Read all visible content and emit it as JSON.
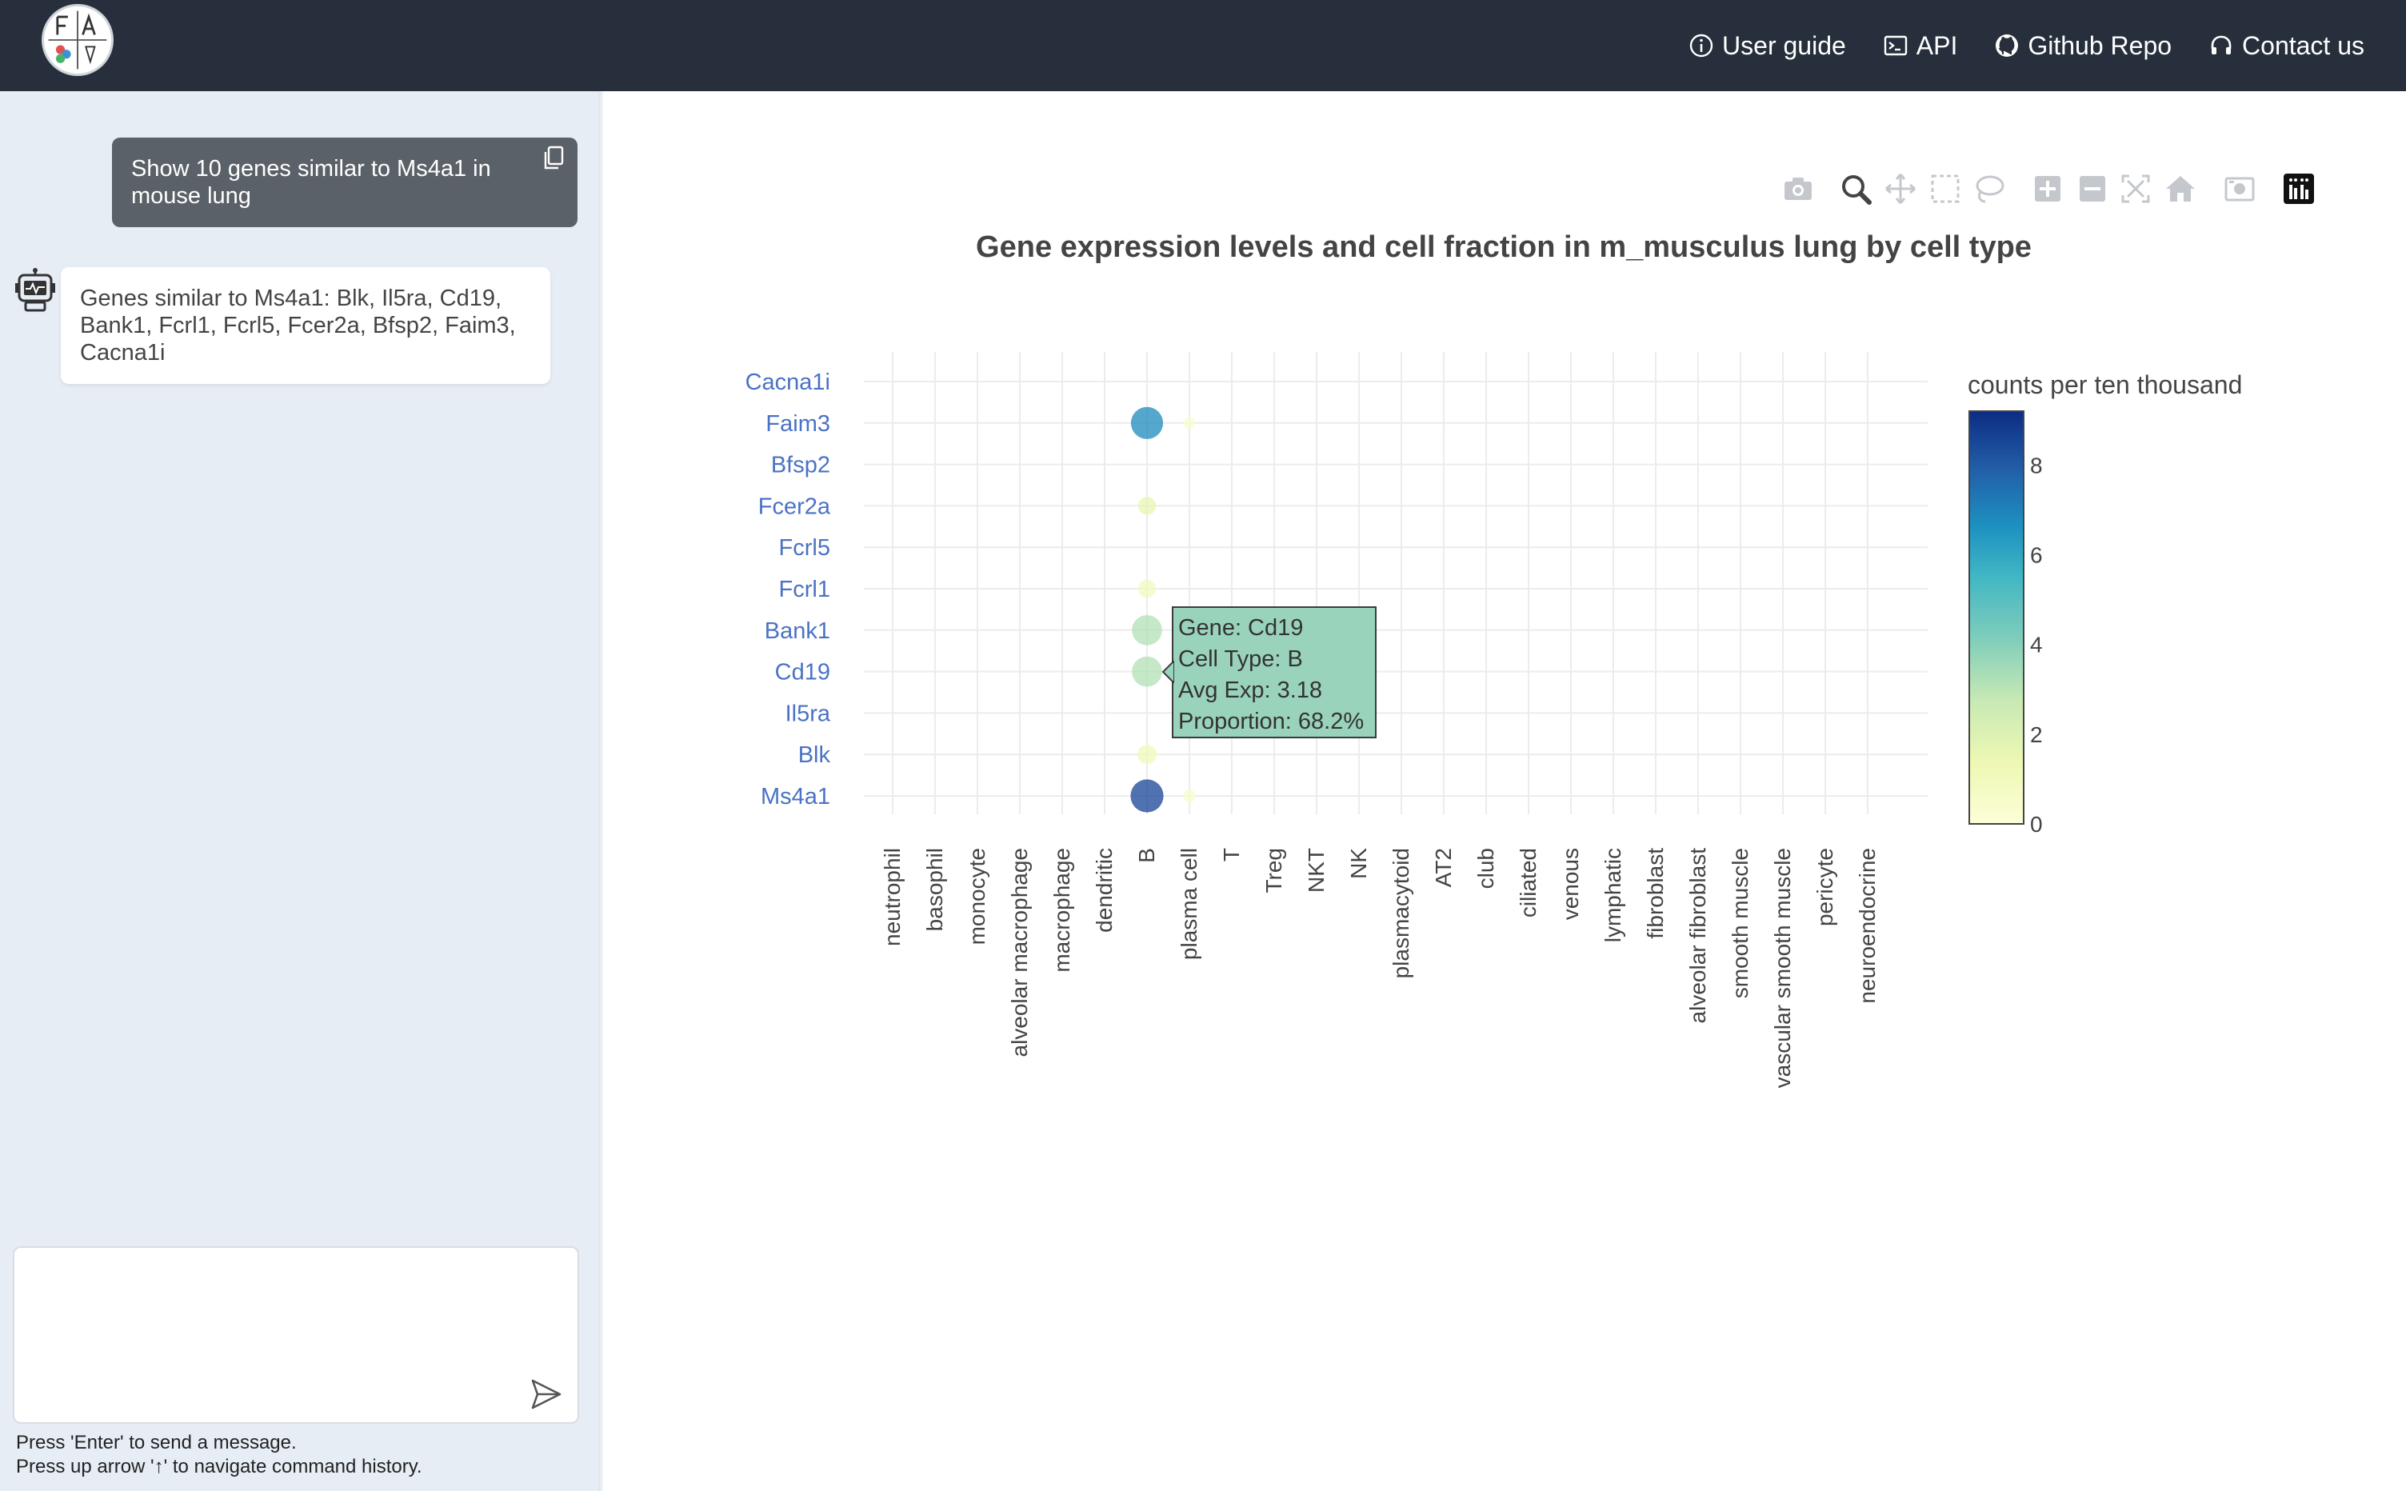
{
  "nav": {
    "user_guide": "User guide",
    "api": "API",
    "github": "Github Repo",
    "contact": "Contact us"
  },
  "chat": {
    "user_message": "Show 10 genes similar to Ms4a1 in mouse lung",
    "bot_message": "Genes similar to Ms4a1: Blk, Il5ra, Cd19, Bank1, Fcrl1, Fcrl5, Fcer2a, Bfsp2, Faim3, Cacna1i",
    "input_value": "",
    "hint_line1": "Press 'Enter' to send a message.",
    "hint_line2": "Press up arrow '↑' to navigate command history."
  },
  "colors": {
    "topbar": "#262f3b",
    "sidebar": "#e7edf5",
    "gene_label": "#4a72c4"
  },
  "toolbar_icons": [
    "camera-icon",
    "zoom-icon",
    "pan-icon",
    "box-select-icon",
    "lasso-select-icon",
    "zoom-in-icon",
    "zoom-out-icon",
    "autoscale-icon",
    "reset-axes-icon",
    "download-image-icon",
    "plotly-logo-icon"
  ],
  "tooltip": {
    "gene": "Gene: Cd19",
    "cell_type": "Cell Type: B",
    "avg_exp": "Avg Exp: 3.18",
    "proportion": "Proportion: 68.2%"
  },
  "chart_data": {
    "type": "scatter",
    "title": "Gene expression levels and cell fraction in m_musculus lung by cell type",
    "colorbar_title": "counts per ten thousand",
    "colorbar_ticks": [
      0,
      2,
      4,
      6,
      8
    ],
    "colorbar_range": [
      0,
      9.2
    ],
    "genes": [
      "Ms4a1",
      "Blk",
      "Il5ra",
      "Cd19",
      "Bank1",
      "Fcrl1",
      "Fcrl5",
      "Fcer2a",
      "Bfsp2",
      "Faim3",
      "Cacna1i"
    ],
    "cell_types": [
      "neutrophil",
      "basophil",
      "monocyte",
      "alveolar macrophage",
      "macrophage",
      "dendritic",
      "B",
      "plasma cell",
      "T",
      "Treg",
      "NKT",
      "NK",
      "plasmacytoid",
      "AT2",
      "club",
      "ciliated",
      "venous",
      "lymphatic",
      "fibroblast",
      "alveolar fibroblast",
      "smooth muscle",
      "vascular smooth muscle",
      "pericyte",
      "neuroendocrine"
    ],
    "points": [
      {
        "gene": "Ms4a1",
        "cell_type": "B",
        "avg_exp": 8.6,
        "proportion": 0.85
      },
      {
        "gene": "Ms4a1",
        "cell_type": "plasma cell",
        "avg_exp": 0.4,
        "proportion": 0.05
      },
      {
        "gene": "Blk",
        "cell_type": "B",
        "avg_exp": 1.2,
        "proportion": 0.2
      },
      {
        "gene": "Cd19",
        "cell_type": "B",
        "avg_exp": 3.18,
        "proportion": 0.682
      },
      {
        "gene": "Bank1",
        "cell_type": "B",
        "avg_exp": 3.2,
        "proportion": 0.68
      },
      {
        "gene": "Fcrl1",
        "cell_type": "B",
        "avg_exp": 1.0,
        "proportion": 0.16
      },
      {
        "gene": "Fcer2a",
        "cell_type": "B",
        "avg_exp": 1.6,
        "proportion": 0.16
      },
      {
        "gene": "Faim3",
        "cell_type": "B",
        "avg_exp": 6.8,
        "proportion": 0.8
      },
      {
        "gene": "Faim3",
        "cell_type": "plasma cell",
        "avg_exp": 0.4,
        "proportion": 0.03
      }
    ]
  }
}
